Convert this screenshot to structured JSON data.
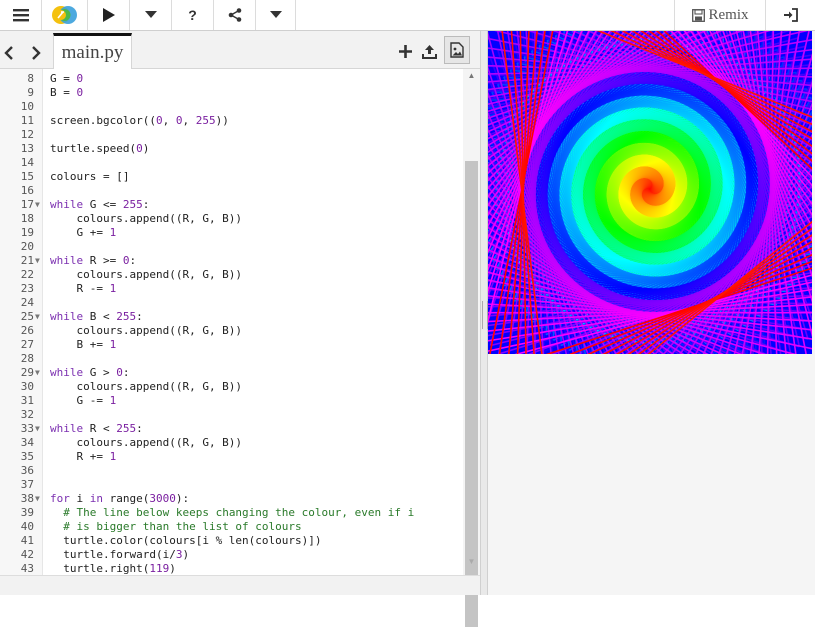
{
  "toolbar": {
    "remix_label": "Remix",
    "icons": [
      "menu-icon",
      "trinket-logo-icon",
      "run-icon",
      "dropdown-icon",
      "help-icon",
      "share-icon",
      "dropdown-icon",
      "save-icon",
      "login-icon"
    ],
    "help_label": "?"
  },
  "editor": {
    "tab_label": "main.py",
    "nav_label": "<>",
    "lines": [
      {
        "n": "8",
        "text": "G = 0"
      },
      {
        "n": "9",
        "text": "B = 0"
      },
      {
        "n": "10",
        "text": ""
      },
      {
        "n": "11",
        "text": "screen.bgcolor((0, 0, 255))"
      },
      {
        "n": "12",
        "text": ""
      },
      {
        "n": "13",
        "text": "turtle.speed(0)"
      },
      {
        "n": "14",
        "text": ""
      },
      {
        "n": "15",
        "text": "colours = []"
      },
      {
        "n": "16",
        "text": ""
      },
      {
        "n": "17",
        "text": "while G <= 255:",
        "fold": true
      },
      {
        "n": "18",
        "text": "    colours.append((R, G, B))"
      },
      {
        "n": "19",
        "text": "    G += 1"
      },
      {
        "n": "20",
        "text": ""
      },
      {
        "n": "21",
        "text": "while R >= 0:",
        "fold": true
      },
      {
        "n": "22",
        "text": "    colours.append((R, G, B))"
      },
      {
        "n": "23",
        "text": "    R -= 1"
      },
      {
        "n": "24",
        "text": ""
      },
      {
        "n": "25",
        "text": "while B < 255:",
        "fold": true
      },
      {
        "n": "26",
        "text": "    colours.append((R, G, B))"
      },
      {
        "n": "27",
        "text": "    B += 1"
      },
      {
        "n": "28",
        "text": ""
      },
      {
        "n": "29",
        "text": "while G > 0:",
        "fold": true
      },
      {
        "n": "30",
        "text": "    colours.append((R, G, B))"
      },
      {
        "n": "31",
        "text": "    G -= 1"
      },
      {
        "n": "32",
        "text": ""
      },
      {
        "n": "33",
        "text": "while R < 255:",
        "fold": true
      },
      {
        "n": "34",
        "text": "    colours.append((R, G, B))"
      },
      {
        "n": "35",
        "text": "    R += 1"
      },
      {
        "n": "36",
        "text": ""
      },
      {
        "n": "37",
        "text": ""
      },
      {
        "n": "38",
        "text": "for i in range(3000):",
        "fold": true
      },
      {
        "n": "39",
        "text": "  # The line below keeps changing the colour, even if i"
      },
      {
        "n": "40",
        "text": "  # is bigger than the list of colours"
      },
      {
        "n": "41",
        "text": "  turtle.color(colours[i % len(colours)])"
      },
      {
        "n": "42",
        "text": "  turtle.forward(i/3)"
      },
      {
        "n": "43",
        "text": "  turtle.right(119)"
      }
    ]
  },
  "colors": {
    "keyword": "#7b2fb0",
    "number": "#7a1fa0",
    "comment": "#2a7a2a",
    "canvas_bg": "#0000ff"
  }
}
